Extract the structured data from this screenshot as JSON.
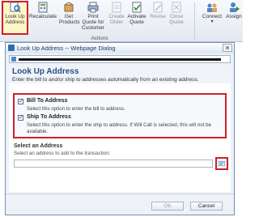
{
  "ribbon": {
    "buttons": [
      {
        "label": "Look Up Address",
        "icon": "lookup-address-icon",
        "enabled": true
      },
      {
        "label": "Recalculate",
        "icon": "recalculate-icon",
        "enabled": true
      },
      {
        "label": "Get Products",
        "icon": "get-products-icon",
        "enabled": true
      },
      {
        "label": "Print Quote for Customer",
        "icon": "print-quote-icon",
        "enabled": true
      },
      {
        "label": "Create Order",
        "icon": "create-order-icon",
        "enabled": false
      },
      {
        "label": "Activate Quote",
        "icon": "activate-quote-icon",
        "enabled": true
      },
      {
        "label": "Revise",
        "icon": "revise-icon",
        "enabled": false
      },
      {
        "label": "Close Quote",
        "icon": "close-quote-icon",
        "enabled": false
      },
      {
        "label": "Connect",
        "icon": "connect-icon",
        "enabled": true
      },
      {
        "label": "Assign",
        "icon": "assign-icon",
        "enabled": true
      }
    ],
    "group_label": "Actions",
    "connect_caret": "▾"
  },
  "dialog": {
    "title": "Look Up Address -- Webpage Dialog",
    "close_glyph": "✕",
    "heading": "Look Up Address",
    "subheading": "Enter the bill to and/or ship to addresses automatically from an existing address.",
    "bill_to": {
      "label": "Bill To Address",
      "description": "Select this option to enter the bill to address.",
      "checked": true,
      "check_glyph": "✓"
    },
    "ship_to": {
      "label": "Ship To Address",
      "description": "Select this option to enter the ship to address. If Will Call is selected, this will not be available.",
      "checked": true,
      "check_glyph": "✓"
    },
    "select_title": "Select an Address",
    "select_desc": "Select an address to add to the transaction:",
    "address_value": "",
    "ok_label": "OK",
    "cancel_label": "Cancel"
  },
  "colors": {
    "highlight": "#d0202a",
    "accent": "#2b4f7e"
  }
}
